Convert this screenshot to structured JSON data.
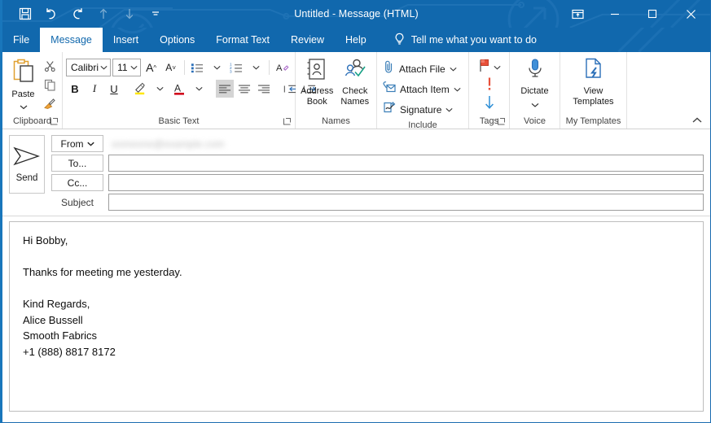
{
  "window": {
    "title": "Untitled  -  Message (HTML)",
    "accent_color": "#1168ad",
    "controls": {
      "ribbon_display_options": "ribbon-display-options",
      "minimize": "minimize",
      "maximize": "maximize",
      "close": "close"
    }
  },
  "quick_access": {
    "items": [
      {
        "name": "save",
        "icon": "save-icon",
        "label": "Save",
        "enabled": true
      },
      {
        "name": "undo",
        "icon": "undo-icon",
        "label": "Undo",
        "enabled": true
      },
      {
        "name": "redo",
        "icon": "redo-icon",
        "label": "Redo",
        "enabled": true
      },
      {
        "name": "previous-item",
        "icon": "arrow-up-icon",
        "label": "Previous Item",
        "enabled": false
      },
      {
        "name": "next-item",
        "icon": "arrow-down-icon",
        "label": "Next Item",
        "enabled": false
      },
      {
        "name": "customize",
        "icon": "chevron-down-icon",
        "label": "Customize Quick Access Toolbar",
        "enabled": true
      }
    ]
  },
  "ribbon": {
    "tabs": [
      {
        "label": "File",
        "active": false
      },
      {
        "label": "Message",
        "active": true
      },
      {
        "label": "Insert",
        "active": false
      },
      {
        "label": "Options",
        "active": false
      },
      {
        "label": "Format Text",
        "active": false
      },
      {
        "label": "Review",
        "active": false
      },
      {
        "label": "Help",
        "active": false
      }
    ],
    "tell_me": {
      "icon": "lightbulb-icon",
      "label": "Tell me what you want to do"
    },
    "collapse_icon": "chevron-up-icon",
    "groups": {
      "clipboard": {
        "label": "Clipboard",
        "has_launcher": true,
        "paste": {
          "label": "Paste",
          "icon": "paste-icon"
        },
        "cut": {
          "label": "Cut",
          "icon": "scissors-icon"
        },
        "copy": {
          "label": "Copy",
          "icon": "copy-icon"
        },
        "format_painter": {
          "label": "Format Painter",
          "icon": "paintbrush-icon"
        }
      },
      "basic_text": {
        "label": "Basic Text",
        "has_launcher": true,
        "font_name": "Calibri (Bod",
        "font_size": "11",
        "buttons_row1": [
          {
            "name": "grow-font",
            "glyph": "A",
            "label": "Increase Font Size"
          },
          {
            "name": "shrink-font",
            "glyph": "A",
            "label": "Decrease Font Size"
          },
          {
            "name": "bullets",
            "glyph": "",
            "label": "Bullets"
          },
          {
            "name": "numbering",
            "glyph": "",
            "label": "Numbering"
          },
          {
            "name": "clear-formatting",
            "glyph": "A",
            "label": "Clear All Formatting"
          }
        ],
        "buttons_row2": [
          {
            "name": "bold",
            "glyph": "B",
            "label": "Bold"
          },
          {
            "name": "italic",
            "glyph": "I",
            "label": "Italic"
          },
          {
            "name": "underline",
            "glyph": "U",
            "label": "Underline"
          },
          {
            "name": "text-highlight-color",
            "glyph": "",
            "label": "Text Highlight Color",
            "color": "#ffe600"
          },
          {
            "name": "font-color",
            "glyph": "A",
            "label": "Font Color",
            "color": "#d0021b"
          },
          {
            "name": "align-left",
            "glyph": "",
            "label": "Align Left",
            "active": true
          },
          {
            "name": "align-center",
            "glyph": "",
            "label": "Center"
          },
          {
            "name": "align-right",
            "glyph": "",
            "label": "Align Right"
          },
          {
            "name": "decrease-indent",
            "glyph": "",
            "label": "Decrease Indent"
          },
          {
            "name": "increase-indent",
            "glyph": "",
            "label": "Increase Indent"
          }
        ]
      },
      "names": {
        "label": "Names",
        "address_book": {
          "line1": "Address",
          "line2": "Book",
          "icon": "address-book-icon"
        },
        "check_names": {
          "line1": "Check",
          "line2": "Names",
          "icon": "check-names-icon"
        }
      },
      "include": {
        "label": "Include",
        "items": [
          {
            "name": "attach-file",
            "label": "Attach File",
            "icon": "paperclip-icon",
            "has_dropdown": true
          },
          {
            "name": "attach-item",
            "label": "Attach Item",
            "icon": "attach-item-icon",
            "has_dropdown": true
          },
          {
            "name": "signature",
            "label": "Signature",
            "icon": "signature-icon",
            "has_dropdown": true
          }
        ]
      },
      "tags": {
        "label": "Tags",
        "has_launcher": true,
        "items": [
          {
            "name": "follow-up-flag",
            "icon": "flag-icon",
            "color": "#e8503a",
            "has_dropdown": true
          },
          {
            "name": "high-importance",
            "icon": "exclamation-icon",
            "color": "#e8503a"
          },
          {
            "name": "low-importance",
            "icon": "arrow-down-icon",
            "color": "#2e8fd6"
          }
        ]
      },
      "voice": {
        "label": "Voice",
        "dictate": {
          "label": "Dictate",
          "icon": "microphone-icon",
          "has_dropdown": true
        }
      },
      "my_templates": {
        "label": "My Templates",
        "view_templates": {
          "line1": "View",
          "line2": "Templates",
          "icon": "template-icon"
        }
      }
    }
  },
  "compose": {
    "send_button": {
      "label": "Send",
      "icon": "send-icon"
    },
    "from": {
      "button_label": "From",
      "value": "",
      "redacted": true
    },
    "to": {
      "button_label": "To...",
      "value": "",
      "placeholder": ""
    },
    "cc": {
      "button_label": "Cc...",
      "value": "",
      "placeholder": ""
    },
    "subject": {
      "label": "Subject",
      "value": "",
      "placeholder": ""
    }
  },
  "body": {
    "lines": [
      "Hi Bobby,",
      "",
      "Thanks for meeting me yesterday.",
      "",
      "Kind Regards,",
      "Alice Bussell",
      "Smooth Fabrics",
      "+1 (888) 8817 8172"
    ]
  }
}
